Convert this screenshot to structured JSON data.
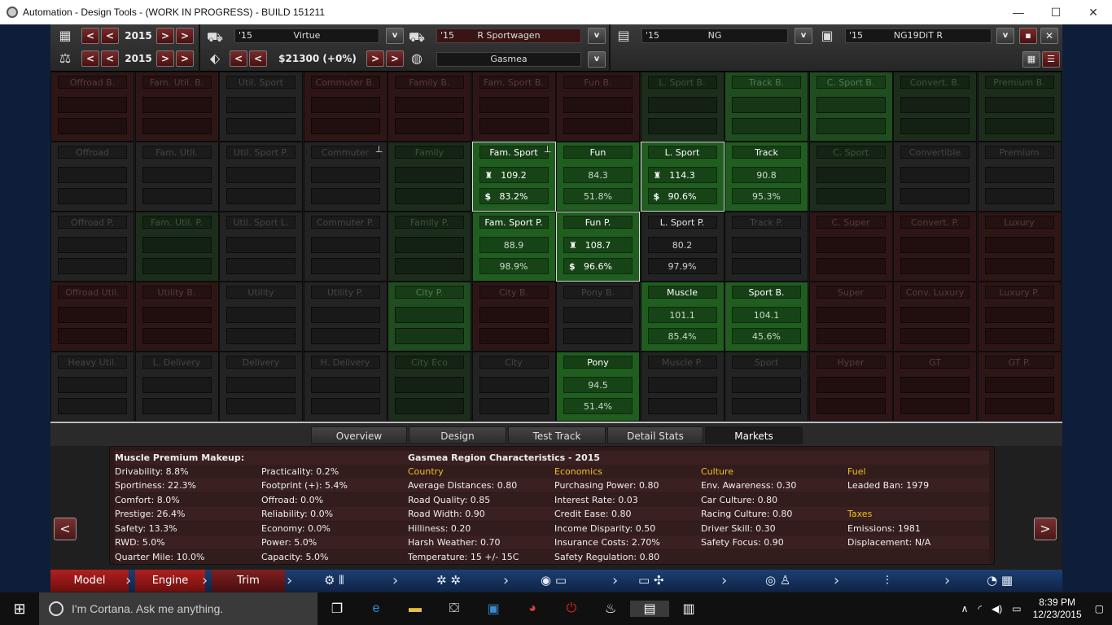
{
  "window": {
    "title": "Automation - Design Tools - (WORK IN PROGRESS) - BUILD 151211",
    "minimize": "—",
    "maximize": "☐",
    "close": "✕"
  },
  "top": {
    "year1": "2015",
    "year2": "2015",
    "price": "$21300 (+0%)",
    "model": {
      "year": "'15",
      "name": "Virtue"
    },
    "trim": {
      "year": "'15",
      "name": "R Sportwagen"
    },
    "engine": {
      "year": "'15",
      "name": "NG"
    },
    "variant": {
      "year": "'15",
      "name": "NG19DiT R"
    },
    "region": "Gasmea",
    "prev": "<",
    "next": ">",
    "dropdown": "v",
    "close": "✕"
  },
  "grid": [
    [
      {
        "l": "Offroad B.",
        "s": "red"
      },
      {
        "l": "Fam. Util. B.",
        "s": "red"
      },
      {
        "l": "Util. Sport",
        "s": "dark"
      },
      {
        "l": "Commuter B.",
        "s": "red"
      },
      {
        "l": "Family B.",
        "s": "red"
      },
      {
        "l": "Fam. Sport B.",
        "s": "red"
      },
      {
        "l": "Fun B.",
        "s": "red"
      },
      {
        "l": "L. Sport B.",
        "s": "dgreen"
      },
      {
        "l": "Track B.",
        "s": "green"
      },
      {
        "l": "C. Sport B.",
        "s": "green"
      },
      {
        "l": "Convert. B.",
        "s": "dgreen"
      },
      {
        "l": "Premium B.",
        "s": "dgreen"
      }
    ],
    [
      {
        "l": "Offroad",
        "s": "dark"
      },
      {
        "l": "Fam. Util.",
        "s": "dark"
      },
      {
        "l": "Util. Sport P.",
        "s": "dark"
      },
      {
        "l": "Commuter",
        "s": "dark",
        "pin": true
      },
      {
        "l": "Family",
        "s": "dgreen"
      },
      {
        "l": "Fam. Sport",
        "s": "act",
        "v1": "109.2",
        "v2": "83.2%",
        "trophy": true,
        "dollar": true,
        "pin": true,
        "sel": true
      },
      {
        "l": "Fun",
        "s": "act",
        "v1": "84.3",
        "v2": "51.8%"
      },
      {
        "l": "L. Sport",
        "s": "act",
        "v1": "114.3",
        "v2": "90.6%",
        "trophy": true,
        "dollar": true,
        "sel": true
      },
      {
        "l": "Track",
        "s": "act",
        "v1": "90.8",
        "v2": "95.3%"
      },
      {
        "l": "C. Sport",
        "s": "dgreen"
      },
      {
        "l": "Convertible",
        "s": "dark"
      },
      {
        "l": "Premium",
        "s": "dark"
      }
    ],
    [
      {
        "l": "Offroad P.",
        "s": "dark"
      },
      {
        "l": "Fam. Util. P.",
        "s": "dgreen"
      },
      {
        "l": "Util. Sport L.",
        "s": "dark"
      },
      {
        "l": "Commuter P.",
        "s": "dark"
      },
      {
        "l": "Family P.",
        "s": "dgreen"
      },
      {
        "l": "Fam. Sport P.",
        "s": "act",
        "v1": "88.9",
        "v2": "98.9%"
      },
      {
        "l": "Fun P.",
        "s": "act",
        "v1": "108.7",
        "v2": "96.6%",
        "trophy": true,
        "dollar": true,
        "sel": true
      },
      {
        "l": "L. Sport P.",
        "s": "dark",
        "bright": true,
        "v1": "80.2",
        "v2": "97.9%"
      },
      {
        "l": "Track P.",
        "s": "dark"
      },
      {
        "l": "C. Super",
        "s": "red"
      },
      {
        "l": "Convert. P.",
        "s": "red"
      },
      {
        "l": "Luxury",
        "s": "red"
      }
    ],
    [
      {
        "l": "Offroad Util.",
        "s": "red"
      },
      {
        "l": "Utility B.",
        "s": "red"
      },
      {
        "l": "Utility",
        "s": "dark"
      },
      {
        "l": "Utility P.",
        "s": "dark"
      },
      {
        "l": "City P.",
        "s": "green"
      },
      {
        "l": "City B.",
        "s": "red"
      },
      {
        "l": "Pony B.",
        "s": "dark"
      },
      {
        "l": "Muscle",
        "s": "act",
        "v1": "101.1",
        "v2": "85.4%"
      },
      {
        "l": "Sport B.",
        "s": "act",
        "v1": "104.1",
        "v2": "45.6%"
      },
      {
        "l": "Super",
        "s": "red"
      },
      {
        "l": "Conv. Luxury",
        "s": "red"
      },
      {
        "l": "Luxury P.",
        "s": "red"
      }
    ],
    [
      {
        "l": "Heavy Util.",
        "s": "dark"
      },
      {
        "l": "L. Delivery",
        "s": "dark"
      },
      {
        "l": "Delivery",
        "s": "dark"
      },
      {
        "l": "H. Delivery",
        "s": "dark"
      },
      {
        "l": "City Eco",
        "s": "dgreen"
      },
      {
        "l": "City",
        "s": "dark"
      },
      {
        "l": "Pony",
        "s": "act",
        "v1": "94.5",
        "v2": "51.4%"
      },
      {
        "l": "Muscle P.",
        "s": "dark"
      },
      {
        "l": "Sport",
        "s": "dark"
      },
      {
        "l": "Hyper",
        "s": "red"
      },
      {
        "l": "GT",
        "s": "red"
      },
      {
        "l": "GT P.",
        "s": "red"
      }
    ]
  ],
  "tabs": [
    "Overview",
    "Design",
    "Test Track",
    "Detail Stats",
    "Markets"
  ],
  "panel": {
    "makeup_title": "Muscle Premium Makeup:",
    "makeup_col1": [
      "Drivability: 8.8%",
      "Sportiness: 22.3%",
      "Comfort: 8.0%",
      "Prestige: 26.4%",
      "Safety: 13.3%",
      "RWD: 5.0%",
      "Quarter Mile: 10.0%"
    ],
    "makeup_col2": [
      "Practicality: 0.2%",
      "Footprint (+): 5.4%",
      "Offroad: 0.0%",
      "Reliability: 0.0%",
      "Economy: 0.0%",
      "Power: 5.0%",
      "Capacity: 5.0%"
    ],
    "region_title": "Gasmea Region Characteristics - 2015",
    "country_h": "Country",
    "country": [
      "Average Distances: 0.80",
      "Road Quality: 0.85",
      "Road Width: 0.90",
      "Hilliness: 0.20",
      "Harsh Weather: 0.70",
      "Temperature: 15 +/- 15C"
    ],
    "economics_h": "Economics",
    "economics": [
      "Purchasing Power: 0.80",
      "Interest Rate: 0.03",
      "Credit Ease: 0.80",
      "Income Disparity: 0.50",
      "Insurance Costs: 2.70%",
      "Safety Regulation: 0.80"
    ],
    "culture_h": "Culture",
    "culture": [
      "Env. Awareness: 0.30",
      "Car Culture: 0.80",
      "Racing Culture: 0.80",
      "Driver Skill: 0.30",
      "Safety Focus: 0.90"
    ],
    "fuel_h": "Fuel",
    "fuel": [
      "Leaded Ban: 1979"
    ],
    "taxes_h": "Taxes",
    "taxes": [
      "Emissions: 1981",
      "Displacement: N/A"
    ],
    "left": "<",
    "right": ">"
  },
  "nav": {
    "model": "Model",
    "engine": "Engine",
    "trim": "Trim"
  },
  "taskbar": {
    "search": "I'm Cortana. Ask me anything.",
    "time": "8:39 PM",
    "date": "12/23/2015"
  }
}
